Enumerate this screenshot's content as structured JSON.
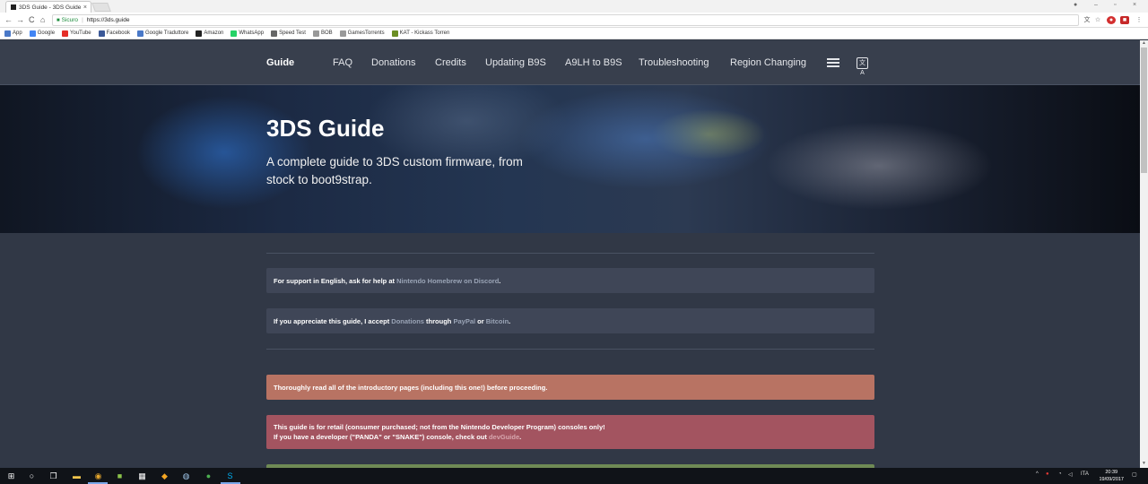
{
  "browser": {
    "tab_title": "3DS Guide - 3DS Guide",
    "tab_close": "×",
    "secure_label": "Sicuro",
    "url": "https://3ds.guide",
    "window_controls": [
      "–",
      "▫",
      "×"
    ],
    "nav_icons": [
      "←",
      "→",
      "C",
      "⌂"
    ]
  },
  "bookmarks": [
    {
      "label": "App",
      "icon": "apps-grid-icon",
      "color": "#4a79c8"
    },
    {
      "label": "Google",
      "icon": "google-icon",
      "color": "#4285f4"
    },
    {
      "label": "YouTube",
      "icon": "youtube-icon",
      "color": "#e52d27"
    },
    {
      "label": "Facebook",
      "icon": "facebook-icon",
      "color": "#3b5998"
    },
    {
      "label": "Google Traduttore",
      "icon": "translate-icon",
      "color": "#4a79c8"
    },
    {
      "label": "Amazon",
      "icon": "amazon-icon",
      "color": "#222222"
    },
    {
      "label": "WhatsApp",
      "icon": "whatsapp-icon",
      "color": "#25d366"
    },
    {
      "label": "Speed Test",
      "icon": "speedtest-icon",
      "color": "#666666"
    },
    {
      "label": "BOB",
      "icon": "page-icon",
      "color": "#999999"
    },
    {
      "label": "GamesTorrents",
      "icon": "page-icon",
      "color": "#999999"
    },
    {
      "label": "KAT - Kickass Torren",
      "icon": "kat-icon",
      "color": "#6b8e23"
    }
  ],
  "site": {
    "brand": "Guide",
    "nav": [
      "FAQ",
      "Donations",
      "Credits",
      "Updating B9S",
      "A9LH to B9S",
      "Troubleshooting",
      "Region Changing"
    ],
    "translate_glyph": "文A"
  },
  "hero": {
    "title": "3DS Guide",
    "subtitle": "A complete guide to 3DS custom firmware, from stock to boot9strap."
  },
  "notices": {
    "support": {
      "prefix": "For support in English, ask for help at ",
      "link": "Nintendo Homebrew on Discord",
      "suffix": "."
    },
    "donate": {
      "prefix": "If you appreciate this guide, I accept ",
      "link1": "Donations",
      "mid1": " through ",
      "link2": "PayPal",
      "mid2": " or ",
      "link3": "Bitcoin",
      "suffix": "."
    },
    "read": "Thoroughly read all of the introductory pages (including this one!) before proceeding.",
    "retail_line1": "This guide is for retail (consumer purchased; not from the Nintendo Developer Program) consoles only!",
    "retail_line2_prefix": "If you have a developer (\"PANDA\" or \"SNAKE\") console, check out ",
    "retail_link": "devGuide",
    "retail_suffix": "."
  },
  "taskbar": {
    "lang": "ITA",
    "time": "20:39",
    "date": "19/09/2017"
  },
  "colors": {
    "nav_bg": "#383f4d",
    "content_bg": "#313846",
    "info_box": "#3f4657",
    "warning_box": "#b87363",
    "danger_box": "#a35460"
  }
}
